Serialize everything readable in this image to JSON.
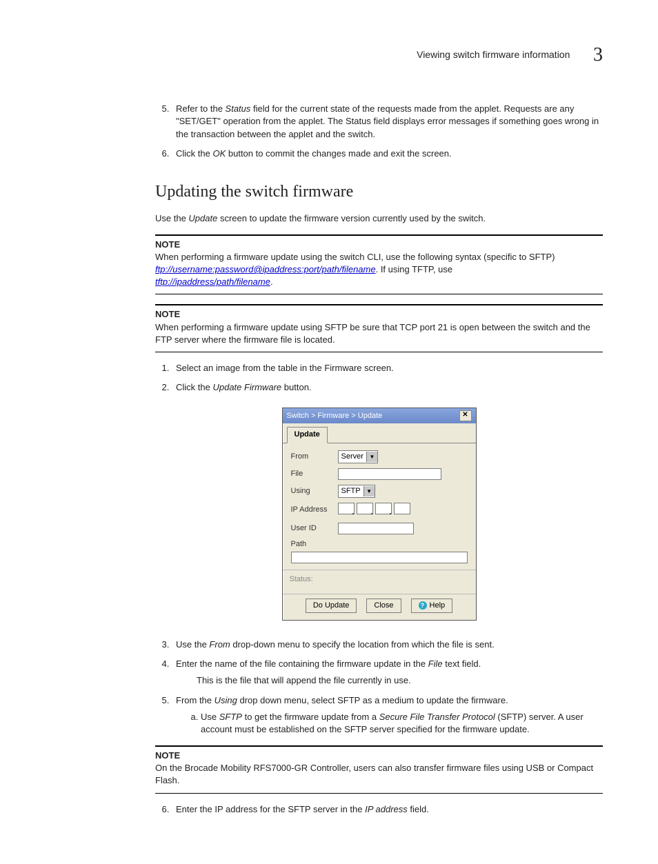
{
  "header": {
    "title": "Viewing switch firmware information",
    "chapter": "3"
  },
  "steps_a": {
    "n5_pre": "Refer to the ",
    "n5_i": "Status",
    "n5_post": " field for the current state of the requests made from the applet. Requests are any \"SET/GET\" operation from the applet. The Status field displays error messages if something goes wrong in the transaction between the applet and the switch.",
    "n6_pre": "Click the ",
    "n6_i": "OK",
    "n6_post": " button to commit the changes made and exit the screen."
  },
  "h2": "Updating the switch firmware",
  "intro_pre": "Use the ",
  "intro_i": "Update",
  "intro_post": " screen to update the firmware version currently used by the switch.",
  "note1": {
    "label": "NOTE",
    "line1": "When performing a firmware update using the switch CLI, use the following syntax (specific to SFTP)",
    "link1": "ftp://username:password@ipaddress:port/path/filename",
    "mid": ". If using TFTP, use ",
    "link2": "tftp://ipaddress/path/filename",
    "end": "."
  },
  "note2": {
    "label": "NOTE",
    "text": "When performing a firmware update using SFTP be sure that TCP port 21 is open between the switch and the FTP server where the firmware file is located."
  },
  "steps_b": {
    "n1": "Select an image from the table in the Firmware screen.",
    "n2_pre": "Click the ",
    "n2_i": "Update Firmware",
    "n2_post": " button."
  },
  "dialog": {
    "title": "Switch > Firmware > Update",
    "close_glyph": "✕",
    "tab": "Update",
    "labels": {
      "from": "From",
      "file": "File",
      "using": "Using",
      "ip": "IP Address",
      "user": "User ID",
      "path": "Path"
    },
    "from_val": "Server",
    "using_val": "SFTP",
    "status_label": "Status:",
    "btn_update": "Do Update",
    "btn_close": "Close",
    "btn_help": "Help"
  },
  "steps_c": {
    "n3_pre": "Use the ",
    "n3_i": "From",
    "n3_post": " drop-down menu to specify the location from which the file is sent.",
    "n4_pre": "Enter the name of the file containing the firmware update in the ",
    "n4_i": "File",
    "n4_post": " text field.",
    "n4_sub": "This is the file that will append the file currently in use.",
    "n5_pre": "From the ",
    "n5_i": "Using",
    "n5_post": " drop down menu, select  SFTP as a medium to update the firmware.",
    "n5a_pre": "Use ",
    "n5a_i1": "SFTP",
    "n5a_mid": " to get the firmware update from a ",
    "n5a_i2": "Secure File Transfer Protocol",
    "n5a_post": " (SFTP) server. A user account must be established on the SFTP server specified for the firmware update."
  },
  "note3": {
    "label": "NOTE",
    "text": "On the Brocade Mobility RFS7000-GR Controller, users can also transfer firmware files using USB or Compact Flash."
  },
  "steps_d": {
    "n6_pre": "Enter the IP address for the SFTP server in the ",
    "n6_i": "IP address",
    "n6_post": " field."
  }
}
